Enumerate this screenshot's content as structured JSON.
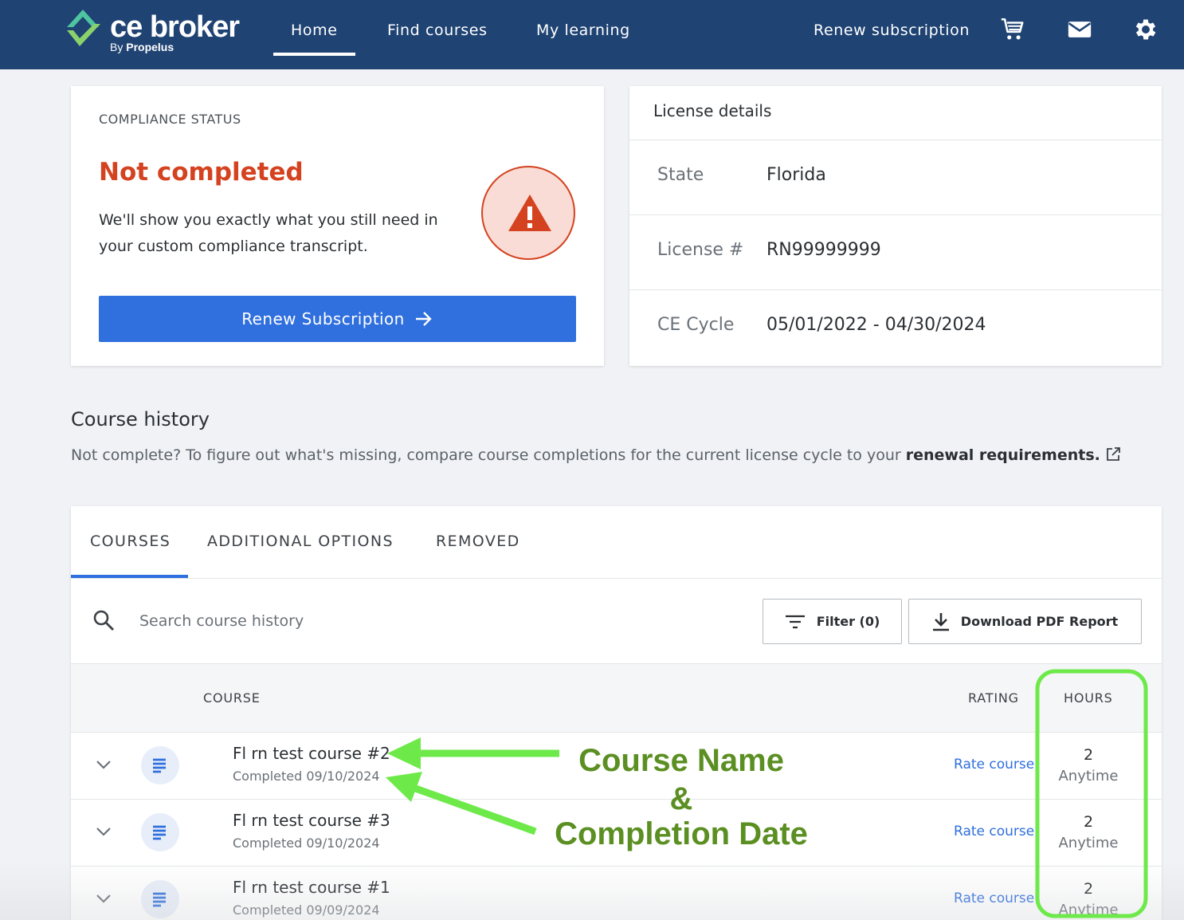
{
  "header": {
    "logo_text": "ce broker",
    "logo_by": "By",
    "logo_company": "Propelus",
    "nav": [
      "Home",
      "Find courses",
      "My learning"
    ],
    "renew_link": "Renew subscription",
    "icons": [
      "cart-icon",
      "mail-icon",
      "gear-icon"
    ],
    "active_nav": "Home"
  },
  "compliance": {
    "label": "COMPLIANCE STATUS",
    "status": "Not completed",
    "description": "We'll show you exactly what you still need in your custom compliance transcript.",
    "button_label": "Renew Subscription",
    "status_color": "#d4421f",
    "icon": "warning-icon"
  },
  "license": {
    "title": "License details",
    "rows": [
      {
        "key": "State",
        "value": "Florida"
      },
      {
        "key": "License #",
        "value": "RN99999999"
      },
      {
        "key": "CE Cycle",
        "value": "05/01/2022 - 04/30/2024"
      }
    ]
  },
  "course_history": {
    "title": "Course history",
    "description_prefix": "Not complete? To figure out what's missing, compare course completions for the current license cycle to your ",
    "description_link": "renewal requirements.",
    "tabs": [
      "COURSES",
      "ADDITIONAL OPTIONS",
      "REMOVED"
    ],
    "active_tab": "COURSES",
    "search_placeholder": "Search course history",
    "filter_label": "Filter (0)",
    "download_label": "Download PDF Report",
    "columns": {
      "course": "COURSE",
      "rating": "RATING",
      "hours": "HOURS"
    },
    "rows": [
      {
        "name": "Fl rn test course #2",
        "completed": "Completed 09/10/2024",
        "rating": "Rate course",
        "hours": "2",
        "hours_type": "Anytime"
      },
      {
        "name": "Fl rn test course #3",
        "completed": "Completed 09/10/2024",
        "rating": "Rate course",
        "hours": "2",
        "hours_type": "Anytime"
      },
      {
        "name": "Fl rn test course #1",
        "completed": "Completed 09/09/2024",
        "rating": "Rate course",
        "hours": "2",
        "hours_type": "Anytime"
      }
    ]
  },
  "annotation": {
    "line1": "Course Name",
    "line2": "&",
    "line3": "Completion Date",
    "color": "#6ee94a"
  },
  "colors": {
    "header_bg": "#1f4373",
    "primary": "#2f6fde",
    "brand_green": "#4ec5a0"
  }
}
